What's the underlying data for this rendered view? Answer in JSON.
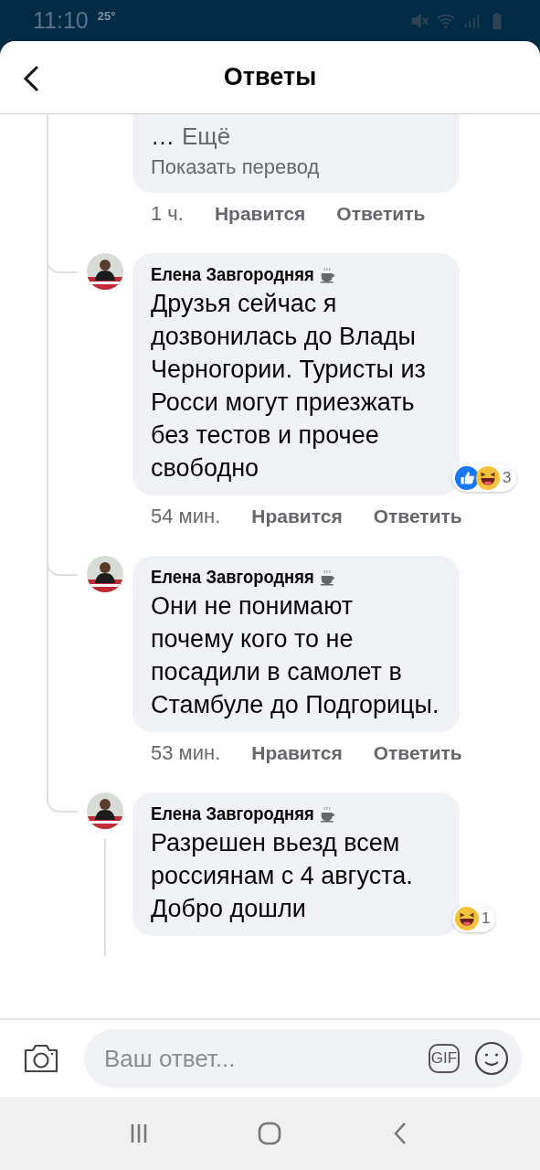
{
  "status_bar": {
    "time": "11:10",
    "temperature": "25°"
  },
  "header": {
    "title": "Ответы"
  },
  "top_comment": {
    "ellipsis": "…",
    "more": "Ещё",
    "translate": "Показать перевод",
    "time": "1 ч.",
    "like": "Нравится",
    "reply": "Ответить"
  },
  "replies": [
    {
      "author": "Елена Завгородняя",
      "text": "Друзья сейчас я дозвонилась до Влады Черногории. Туристы из Росси могут приезжать без тестов и прочее свободно",
      "reactions": [
        {
          "kind": "like"
        },
        {
          "kind": "haha"
        }
      ],
      "reaction_count": "3",
      "time": "54 мин.",
      "like": "Нравится",
      "reply": "Ответить",
      "thread_continues": false
    },
    {
      "author": "Елена Завгородняя",
      "text": "Они не понимают почему кого то не посадили в самолет в Стамбуле до Подгорицы.",
      "time": "53 мин.",
      "like": "Нравится",
      "reply": "Ответить",
      "thread_continues": false
    },
    {
      "author": "Елена Завгородняя",
      "text": "Разрешен вьезд всем россиянам с 4 августа. Добро дошли",
      "reactions": [
        {
          "kind": "haha"
        }
      ],
      "reaction_count": "1",
      "thread_continues": true
    }
  ],
  "composer": {
    "placeholder": "Ваш ответ...",
    "gif": "GIF"
  }
}
